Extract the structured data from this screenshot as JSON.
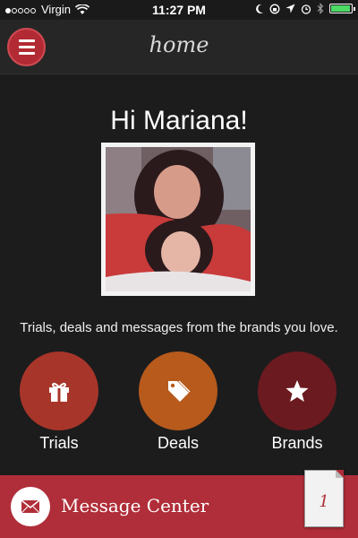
{
  "status_bar": {
    "carrier": "Virgin",
    "time": "11:27 PM",
    "signal_bars": 1,
    "battery_level": 0.95,
    "icons": [
      "wifi-icon",
      "moon-icon",
      "orientation-lock-icon",
      "location-icon",
      "alarm-icon",
      "bluetooth-icon",
      "battery-icon"
    ]
  },
  "nav": {
    "title": "home",
    "menu_icon": "hamburger-icon"
  },
  "greeting": "Hi Mariana!",
  "tagline": "Trials, deals and messages from the brands you love.",
  "categories": [
    {
      "label": "Trials",
      "icon": "gift-icon",
      "color": "#a8352a"
    },
    {
      "label": "Deals",
      "icon": "tag-icon",
      "color": "#b75a1c"
    },
    {
      "label": "Brands",
      "icon": "star-icon",
      "color": "#6b1a1f"
    }
  ],
  "message_center": {
    "label": "Message Center",
    "unread_count": "1",
    "icon": "envelope-icon",
    "color": "#b02e39"
  }
}
